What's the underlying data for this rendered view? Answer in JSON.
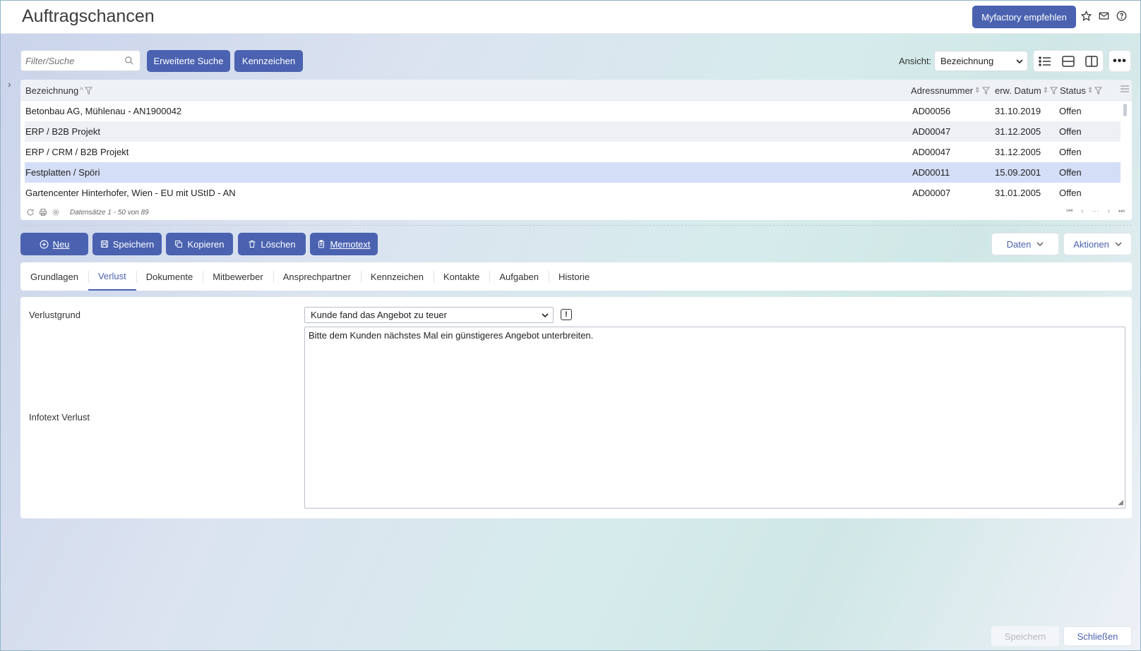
{
  "header": {
    "title": "Auftragschancen",
    "recommend_label": "Myfactory empfehlen"
  },
  "toolbar": {
    "search_placeholder": "Filter/Suche",
    "extended_search_label": "Erweiterte Suche",
    "kennzeichen_label": "Kennzeichen",
    "ansicht_label": "Ansicht:",
    "ansicht_value": "Bezeichnung"
  },
  "grid": {
    "columns": [
      "Bezeichnung",
      "Adressnummer",
      "erw. Datum",
      "Status"
    ],
    "rows": [
      [
        "Betonbau AG, Mühlenau - AN1900042",
        "AD00056",
        "31.10.2019",
        "Offen"
      ],
      [
        "ERP / B2B Projekt",
        "AD00047",
        "31.12.2005",
        "Offen"
      ],
      [
        "ERP / CRM / B2B Projekt",
        "AD00047",
        "31.12.2005",
        "Offen"
      ],
      [
        "Festplatten / Spöri",
        "AD00011",
        "15.09.2001",
        "Offen"
      ],
      [
        "Gartencenter Hinterhofer, Wien - EU mit UStID - AN",
        "AD00007",
        "31.01.2005",
        "Offen"
      ]
    ],
    "record_count": "Datensätze 1 - 50 von 89"
  },
  "actions": {
    "new": "Neu",
    "save": "Speichern",
    "copy": "Kopieren",
    "delete": "Löschen",
    "memo": "Memotext",
    "data": "Daten",
    "actions": "Aktionen"
  },
  "tabs": [
    "Grundlagen",
    "Verlust",
    "Dokumente",
    "Mitbewerber",
    "Ansprechpartner",
    "Kennzeichen",
    "Kontakte",
    "Aufgaben",
    "Historie"
  ],
  "form": {
    "reason_label": "Verlustgrund",
    "reason_value": "Kunde fand das Angebot zu teuer",
    "info_label": "Infotext Verlust",
    "info_value": "Bitte dem Kunden nächstes Mal ein günstigeres Angebot unterbreiten."
  },
  "footer": {
    "save": "Speichern",
    "close": "Schließen"
  },
  "colors": {
    "accent": "#4a62b0",
    "selected_row": "#d5def7"
  }
}
